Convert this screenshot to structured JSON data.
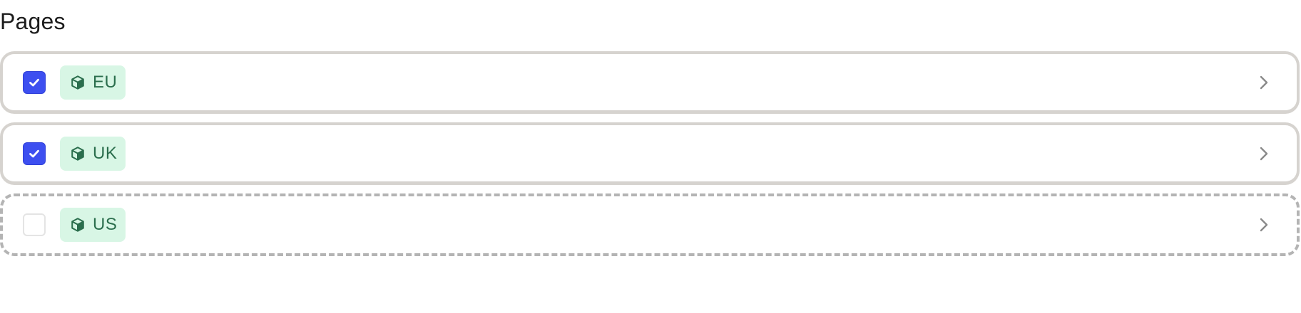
{
  "section": {
    "title": "Pages"
  },
  "pages": [
    {
      "label": "EU",
      "checked": true,
      "style": "solid",
      "icon": "package-icon",
      "chevron": "chevron-right-icon"
    },
    {
      "label": "UK",
      "checked": true,
      "style": "solid",
      "icon": "package-icon",
      "chevron": "chevron-right-icon"
    },
    {
      "label": "US",
      "checked": false,
      "style": "dashed",
      "icon": "package-icon",
      "chevron": "chevron-right-icon"
    }
  ],
  "colors": {
    "checkbox_checked": "#3d4ff0",
    "tag_background": "#d8f6e5",
    "tag_text": "#2b6e4d",
    "row_border": "#d6d3cf",
    "row_border_dashed": "#b4b4b4"
  }
}
